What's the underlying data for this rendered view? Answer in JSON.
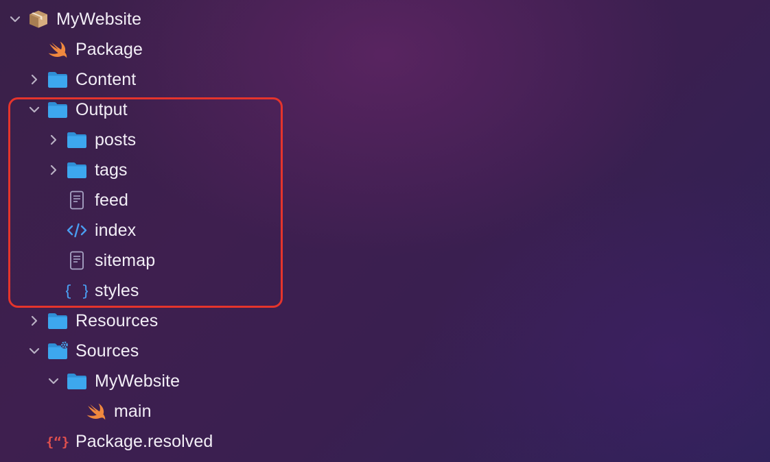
{
  "colors": {
    "folder": "#3da7ee",
    "highlight": "#e5342c",
    "chevron": "#b9b1c4",
    "text": "#f2eef6"
  },
  "tree": {
    "items": [
      {
        "label": "MyWebsite",
        "icon": "package-icon",
        "chevron": "expanded"
      },
      {
        "label": "Package",
        "icon": "swift-icon",
        "chevron": "none"
      },
      {
        "label": "Content",
        "icon": "folder-icon",
        "chevron": "collapsed"
      },
      {
        "label": "Output",
        "icon": "folder-icon",
        "chevron": "expanded"
      },
      {
        "label": "posts",
        "icon": "folder-icon",
        "chevron": "collapsed"
      },
      {
        "label": "tags",
        "icon": "folder-icon",
        "chevron": "collapsed"
      },
      {
        "label": "feed",
        "icon": "document-icon",
        "chevron": "none"
      },
      {
        "label": "index",
        "icon": "code-icon",
        "chevron": "none"
      },
      {
        "label": "sitemap",
        "icon": "document-icon",
        "chevron": "none"
      },
      {
        "label": "styles",
        "icon": "braces-icon",
        "chevron": "none"
      },
      {
        "label": "Resources",
        "icon": "folder-icon",
        "chevron": "collapsed"
      },
      {
        "label": "Sources",
        "icon": "settings-folder-icon",
        "chevron": "expanded"
      },
      {
        "label": "MyWebsite",
        "icon": "folder-icon",
        "chevron": "expanded"
      },
      {
        "label": "main",
        "icon": "swift-icon",
        "chevron": "none"
      },
      {
        "label": "Package.resolved",
        "icon": "json-icon",
        "chevron": "none"
      }
    ]
  }
}
